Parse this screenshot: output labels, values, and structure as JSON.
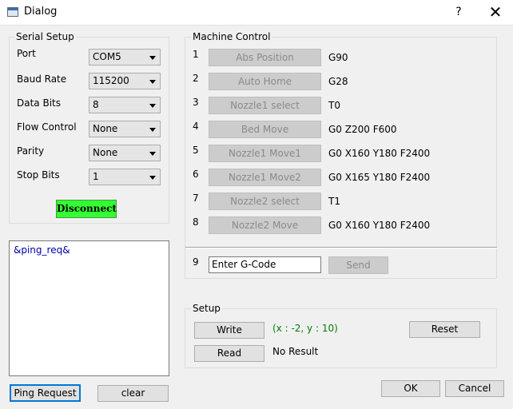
{
  "window": {
    "title": "Dialog",
    "help": "?",
    "close": "✕"
  },
  "serial_setup": {
    "title": "Serial Setup",
    "fields": [
      {
        "label": "Port",
        "value": "COM5"
      },
      {
        "label": "Baud Rate",
        "value": "115200"
      },
      {
        "label": "Data Bits",
        "value": "8"
      },
      {
        "label": "Flow Control",
        "value": "None"
      },
      {
        "label": "Parity",
        "value": "None"
      },
      {
        "label": "Stop Bits",
        "value": "1"
      }
    ],
    "disconnect_label": "Disconnect"
  },
  "log": {
    "text": "&ping_req&"
  },
  "ping_request_label": "Ping Request",
  "clear_label": "clear",
  "machine_control": {
    "title": "Machine Control",
    "commands": [
      {
        "num": "1",
        "button": "Abs Position",
        "gcode": "G90"
      },
      {
        "num": "2",
        "button": "Auto Home",
        "gcode": "G28"
      },
      {
        "num": "3",
        "button": "Nozzle1 select",
        "gcode": "T0"
      },
      {
        "num": "4",
        "button": "Bed Move",
        "gcode": "G0 Z200 F600"
      },
      {
        "num": "5",
        "button": "Nozzle1 Move1",
        "gcode": "G0 X160 Y180 F2400"
      },
      {
        "num": "6",
        "button": "Nozzle1 Move2",
        "gcode": "G0 X165 Y180 F2400"
      },
      {
        "num": "7",
        "button": "Nozzle2 select",
        "gcode": "T1"
      },
      {
        "num": "8",
        "button": "Nozzle2 Move",
        "gcode": "G0 X160 Y180 F2400"
      }
    ],
    "custom": {
      "num": "9",
      "input_value": "Enter G-Code",
      "send_label": "Send"
    }
  },
  "setup": {
    "title": "Setup",
    "write_label": "Write",
    "coords_text": "(x : -2, y : 10)",
    "reset_label": "Reset",
    "read_label": "Read",
    "result_text": "No Result"
  },
  "ok_label": "OK",
  "cancel_label": "Cancel",
  "colors": {
    "disconnect_bg": "#33ff33",
    "log_text": "#0000aa",
    "coords_text": "#008000",
    "focus_border": "#0078d7"
  }
}
